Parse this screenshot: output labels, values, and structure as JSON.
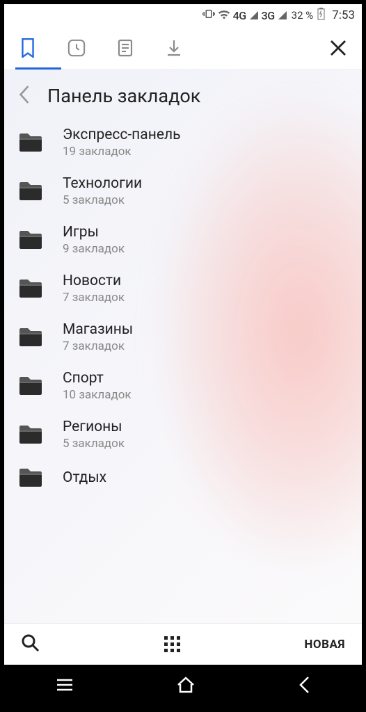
{
  "status": {
    "net1": "4G",
    "net2": "3G",
    "battery": "32 %",
    "time": "7:53"
  },
  "pageTitle": "Панель закладок",
  "folders": [
    {
      "name": "Экспресс-панель",
      "count": "19 закладок"
    },
    {
      "name": "Технологии",
      "count": "5 закладок"
    },
    {
      "name": "Игры",
      "count": "9 закладок"
    },
    {
      "name": "Новости",
      "count": "7 закладок"
    },
    {
      "name": "Магазины",
      "count": "7 закладок"
    },
    {
      "name": "Спорт",
      "count": "10 закладок"
    },
    {
      "name": "Регионы",
      "count": "5 закладок"
    },
    {
      "name": "Отдых",
      "count": ""
    }
  ],
  "bottomBar": {
    "newLabel": "НОВАЯ"
  }
}
